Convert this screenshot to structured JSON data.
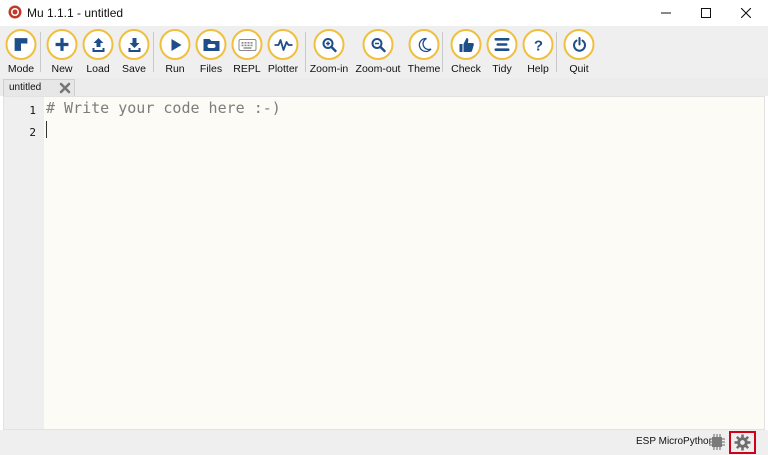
{
  "window": {
    "title": "Mu 1.1.1 - untitled",
    "logo_icon": "mu-logo-icon"
  },
  "toolbar": {
    "accent_color": "#f0bf3e",
    "buttons": [
      {
        "id": "mode",
        "label": "Mode",
        "icon": "mode-icon"
      },
      {
        "id": "new",
        "label": "New",
        "icon": "plus-icon"
      },
      {
        "id": "load",
        "label": "Load",
        "icon": "upload-icon"
      },
      {
        "id": "save",
        "label": "Save",
        "icon": "download-icon"
      },
      {
        "id": "run",
        "label": "Run",
        "icon": "play-icon"
      },
      {
        "id": "files",
        "label": "Files",
        "icon": "folder-icon"
      },
      {
        "id": "repl",
        "label": "REPL",
        "icon": "keyboard-icon"
      },
      {
        "id": "plotter",
        "label": "Plotter",
        "icon": "pulse-icon"
      },
      {
        "id": "zoom_in",
        "label": "Zoom-in",
        "icon": "zoom-in-icon"
      },
      {
        "id": "zoom_out",
        "label": "Zoom-out",
        "icon": "zoom-out-icon"
      },
      {
        "id": "theme",
        "label": "Theme",
        "icon": "moon-icon"
      },
      {
        "id": "check",
        "label": "Check",
        "icon": "thumbs-up-icon"
      },
      {
        "id": "tidy",
        "label": "Tidy",
        "icon": "lines-icon"
      },
      {
        "id": "help",
        "label": "Help",
        "icon": "question-icon"
      },
      {
        "id": "quit",
        "label": "Quit",
        "icon": "power-icon"
      }
    ]
  },
  "tabs": [
    {
      "label": "untitled",
      "active": true
    }
  ],
  "editor": {
    "line_numbers": [
      "1",
      "2"
    ],
    "lines": [
      "# Write your code here :-)",
      ""
    ]
  },
  "statusbar": {
    "mode": "ESP MicroPython",
    "device_icon": "chip-icon",
    "settings_icon": "gear-icon",
    "highlight_color": "#d0021b"
  }
}
